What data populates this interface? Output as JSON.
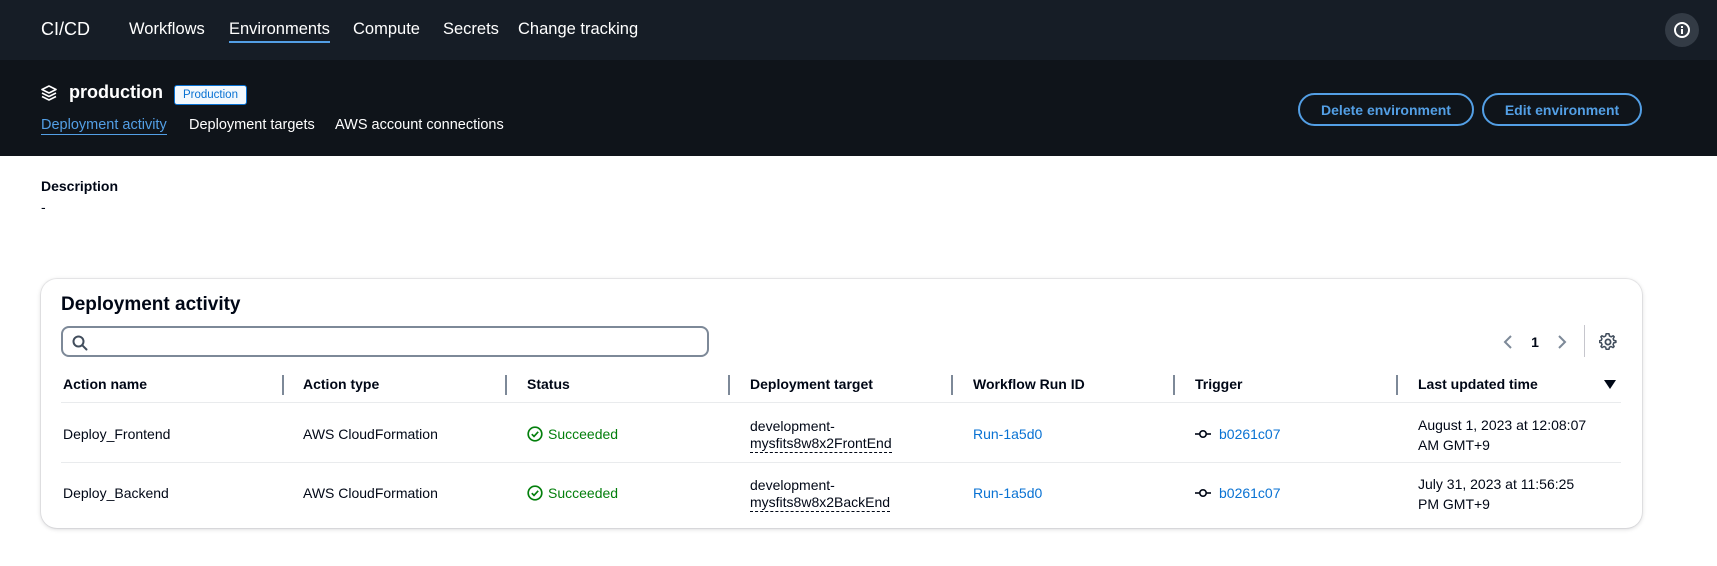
{
  "topnav": {
    "brand": "CI/CD",
    "items": [
      {
        "label": "Workflows"
      },
      {
        "label": "Environments",
        "active": true
      },
      {
        "label": "Compute"
      },
      {
        "label": "Secrets"
      },
      {
        "label": "Change tracking"
      }
    ],
    "info_icon": "info-circle-icon"
  },
  "environment": {
    "icon": "layers-icon",
    "name": "production",
    "badge": "Production",
    "tabs": [
      {
        "label": "Deployment activity",
        "active": true
      },
      {
        "label": "Deployment targets"
      },
      {
        "label": "AWS account connections"
      }
    ],
    "delete_label": "Delete environment",
    "edit_label": "Edit environment"
  },
  "description": {
    "label": "Description",
    "value": "-"
  },
  "deployment_activity": {
    "title": "Deployment activity",
    "search": {
      "placeholder": "",
      "value": ""
    },
    "page": "1",
    "columns": [
      "Action name",
      "Action type",
      "Status",
      "Deployment target",
      "Workflow Run ID",
      "Trigger",
      "Last updated time"
    ],
    "rows": [
      {
        "action_name": "Deploy_Frontend",
        "action_type": "AWS CloudFormation",
        "status": "Succeeded",
        "target_line1": "development-",
        "target_line2": "mysfits8w8x2FrontEnd",
        "run_id": "Run-1a5d0",
        "trigger": "b0261c07",
        "updated_line1": "August 1, 2023 at 12:08:07",
        "updated_line2": "AM GMT+9"
      },
      {
        "action_name": "Deploy_Backend",
        "action_type": "AWS CloudFormation",
        "status": "Succeeded",
        "target_line1": "development-",
        "target_line2": "mysfits8w8x2BackEnd",
        "run_id": "Run-1a5d0",
        "trigger": "b0261c07",
        "updated_line1": "July 31, 2023 at 11:56:25",
        "updated_line2": "PM GMT+9"
      }
    ]
  },
  "colors": {
    "topnav_bg": "#161d26",
    "header_bg": "#0f141a",
    "link": "#0972d3",
    "success": "#037f0c",
    "accent": "#539fe5"
  }
}
